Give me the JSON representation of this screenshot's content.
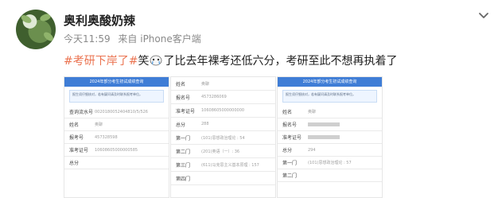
{
  "post": {
    "username": "奥利奥酸奶辣",
    "time": "今天11:59",
    "source": "来自 iPhone客户端",
    "tag": "#考研下岸了#",
    "text_a": "笑",
    "text_b": "了比去年裸考还低六分，考研至此不想再执着了"
  },
  "image1": {
    "title": "2024年部分考生初试成绩查询",
    "notice": "报生须仔细核对，若有疑问请及时联系报考单位。",
    "rows": [
      {
        "k": "查询流水号",
        "v": "0020180052404810/5/526"
      },
      {
        "k": "姓名",
        "v": "奥聊"
      },
      {
        "k": "报考号",
        "v": "457328598"
      },
      {
        "k": "准考证号",
        "v": "10608605000000585"
      },
      {
        "k": "总分",
        "v": ""
      }
    ]
  },
  "image2": {
    "rows": [
      {
        "k": "姓名",
        "v": "奥聊"
      },
      {
        "k": "报名号",
        "v": "4573286069"
      },
      {
        "k": "准考证号",
        "v": "10608605000000000"
      },
      {
        "k": "总分",
        "v": "288"
      },
      {
        "k": "第一门",
        "v": "(101)思想政治理论 : 54"
      },
      {
        "k": "第二门",
        "v": "(201)英语（一）: 36"
      },
      {
        "k": "第三门",
        "v": "(611)马克思主义基本原理 : 157"
      },
      {
        "k": "第四门",
        "v": ""
      }
    ]
  },
  "image3": {
    "title": "2024年部分考生初试成绩查询",
    "notice": "报生须仔细核对，若有疑问请及时联系报考单位。",
    "rows": [
      {
        "k": "姓名",
        "v": "奥聊"
      },
      {
        "k": "报名号",
        "v": ""
      },
      {
        "k": "准考证号",
        "v": ""
      },
      {
        "k": "总分",
        "v": "294"
      },
      {
        "k": "第一门",
        "v": "(101)思想政治理论 : 57"
      },
      {
        "k": "第二门",
        "v": ""
      }
    ]
  }
}
